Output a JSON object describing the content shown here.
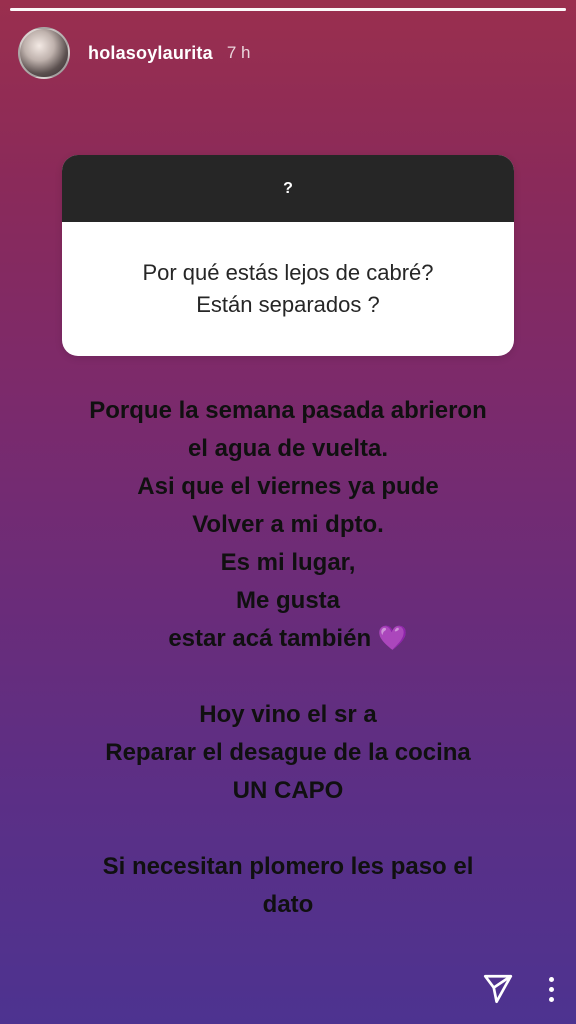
{
  "story": {
    "progress_fraction": 1.0,
    "username": "holasoylaurita",
    "time_ago": "7 h",
    "question_sticker": {
      "header": "?",
      "text": "Por qué estás lejos de cabré?\nEstán separados ?"
    },
    "answer_lines": [
      "Porque la semana pasada abrieron",
      "el agua de vuelta.",
      "Asi que el viernes ya pude",
      "Volver a mi dpto.",
      "Es mi lugar,",
      "Me gusta",
      "estar acá también",
      "",
      "Hoy vino el sr a",
      "Reparar el desague de la cocina",
      "UN CAPO",
      "",
      "Si necesitan plomero les paso el",
      "dato"
    ],
    "heart_emoji": "💜"
  },
  "icons": {
    "send": "paper-plane-icon",
    "more": "more-options-icon"
  },
  "colors": {
    "gradient_top": "#9a2f4e",
    "gradient_bottom": "#4d3390",
    "sticker_header_bg": "#262626"
  }
}
